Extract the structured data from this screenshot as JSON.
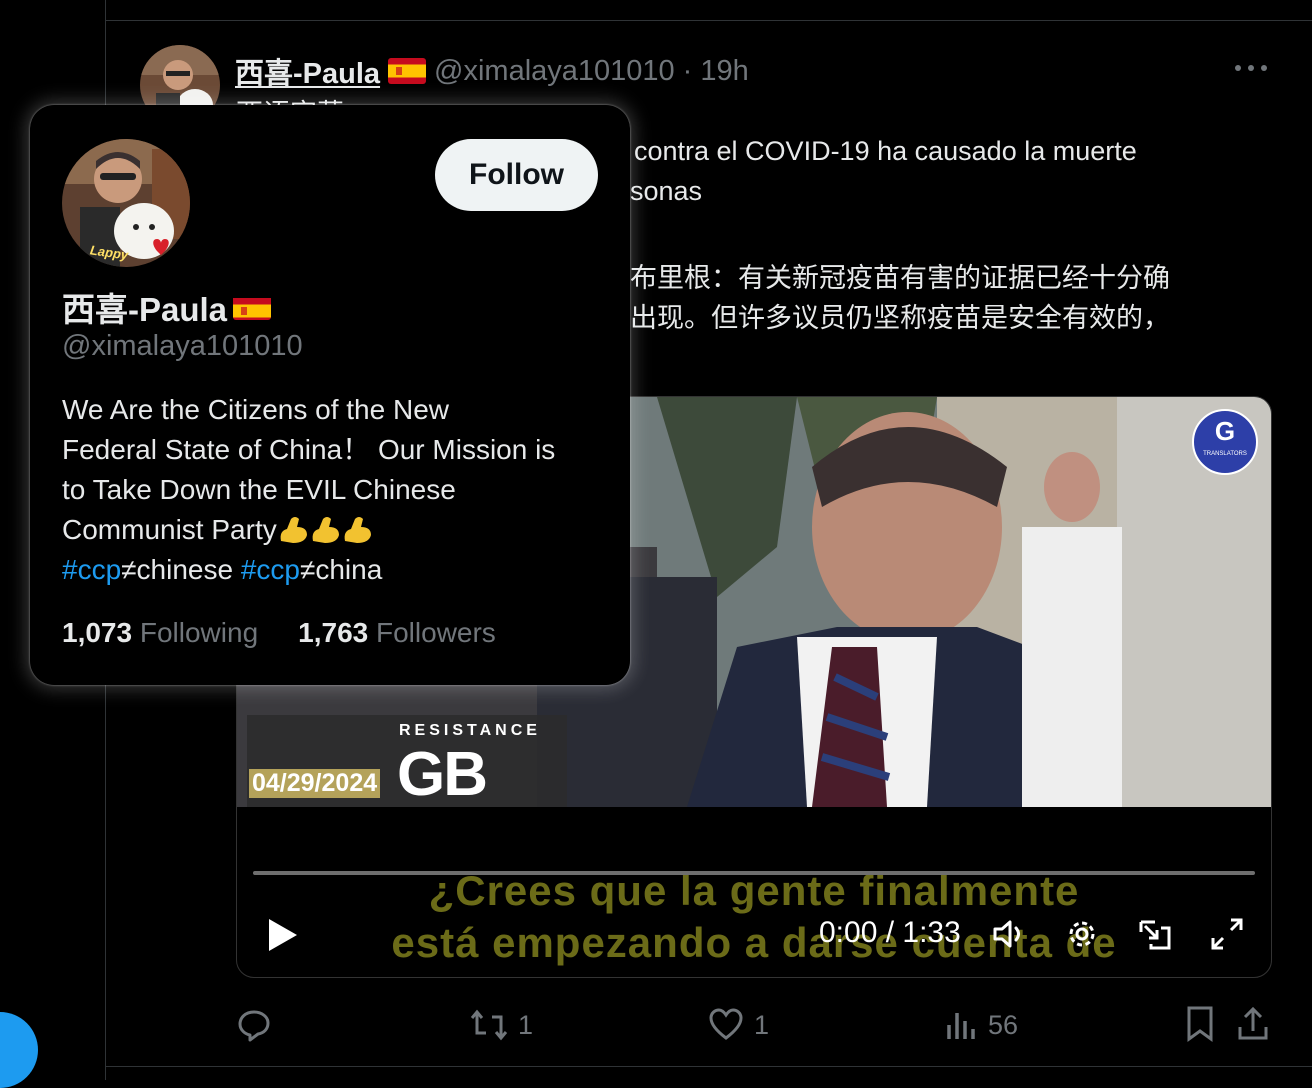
{
  "tweet": {
    "author_name": "西喜-Paula",
    "handle": "@ximalaya101010",
    "separator": "·",
    "time": "19h",
    "partial_line": "西语字幕",
    "lines": [
      "contra el COVID-19 ha causado la muerte",
      "sonas",
      "布里根：有关新冠疫苗有害的证据已经十分确",
      "出现。但许多议员仍坚称疫苗是安全有效的，"
    ],
    "video": {
      "date_stamp": "04/29/2024",
      "logo_top": "RESISTANCE",
      "logo_main": "GB",
      "subtitle_line1": "¿Crees que la gente finalmente",
      "subtitle_line2": "está empezando a darse cuenta de",
      "time": "0:00 / 1:33",
      "translator_badge": "G",
      "translator_label": "TRANSLATORS"
    },
    "actions": {
      "replies": "",
      "retweets": "1",
      "likes": "1",
      "views": "56"
    }
  },
  "hover_card": {
    "name": "西喜-Paula",
    "handle": "@ximalaya101010",
    "follow_label": "Follow",
    "bio_line1": "We Are the Citizens of the New",
    "bio_line2": "Federal State of China！ Our Mission is",
    "bio_line3": "to Take Down the EVIL Chinese",
    "bio_line4": "Communist Party",
    "tag1": "#ccp",
    "tag1_rest": "≠chinese ",
    "tag2": "#ccp",
    "tag2_rest": "≠china",
    "following_count": "1,073",
    "following_label": "Following",
    "followers_count": "1,763",
    "followers_label": "Followers",
    "avatar_caption": "Lappy"
  },
  "colors": {
    "accent": "#1d9bf0",
    "muted": "#71767b",
    "subtitle": "#6b6b18"
  }
}
